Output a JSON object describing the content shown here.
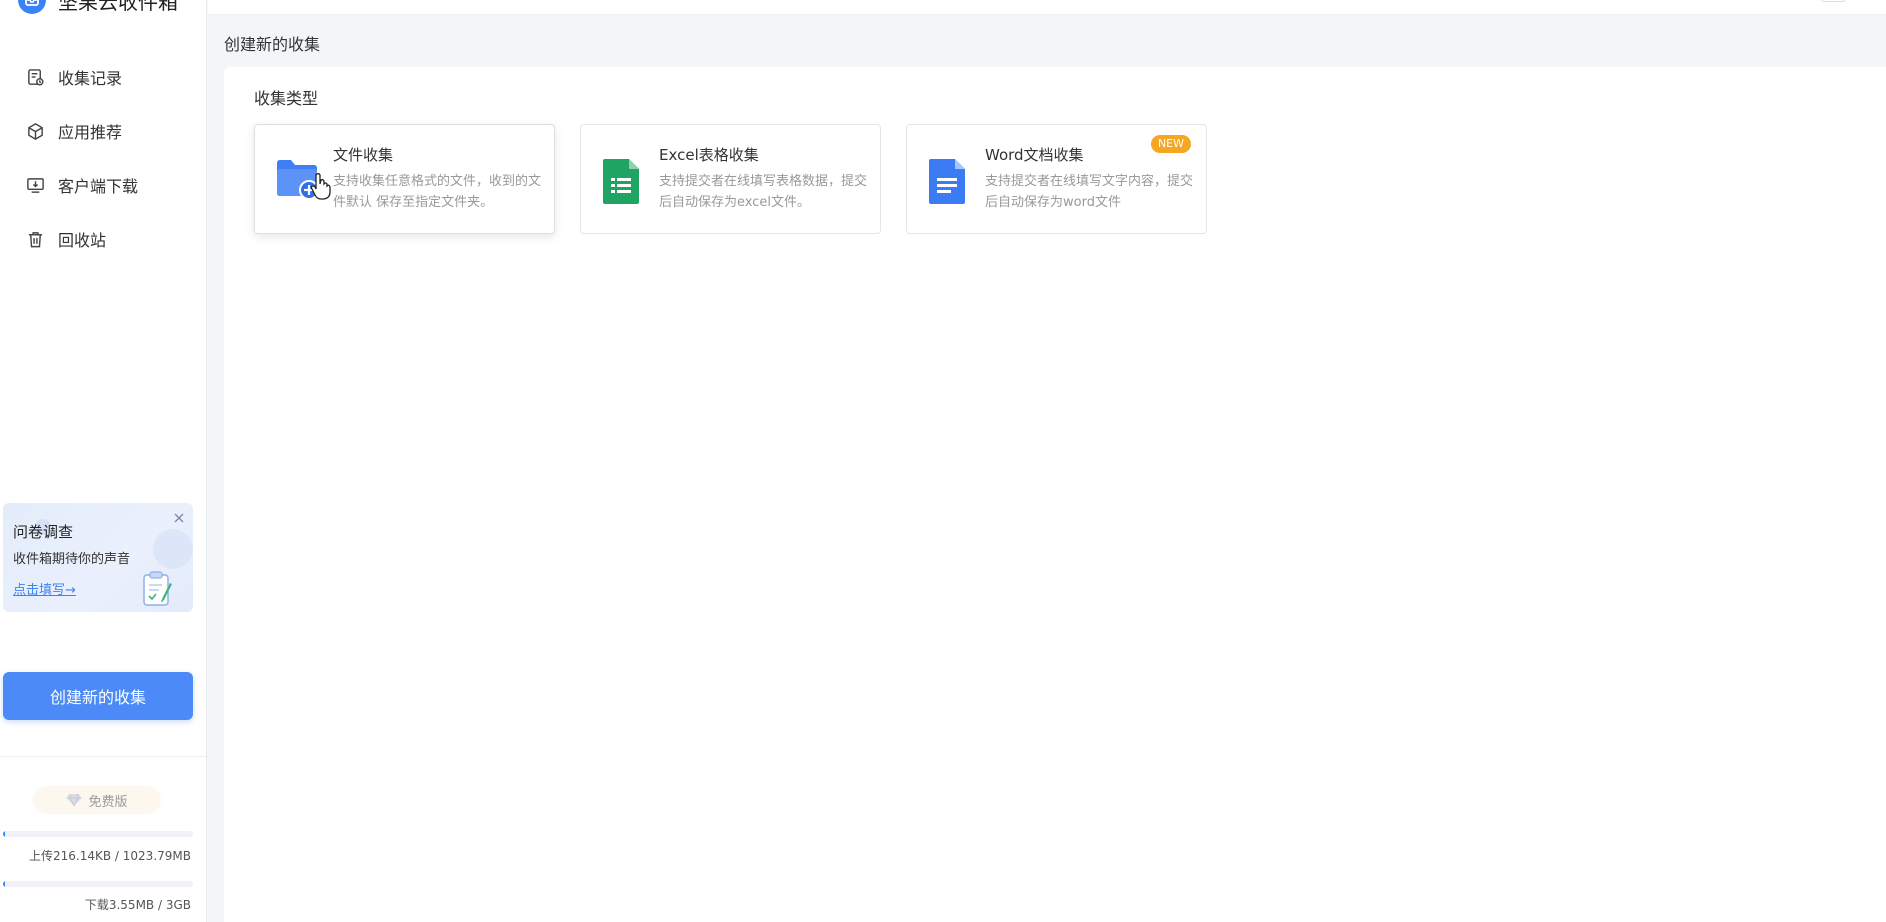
{
  "app": {
    "name": "坚果云收件箱"
  },
  "sidebar": {
    "items": [
      {
        "label": "收集记录",
        "icon": "records-icon"
      },
      {
        "label": "应用推荐",
        "icon": "cube-icon"
      },
      {
        "label": "客户端下载",
        "icon": "download-monitor-icon"
      },
      {
        "label": "回收站",
        "icon": "trash-icon"
      }
    ],
    "survey": {
      "title": "问卷调查",
      "subtitle": "收件箱期待你的声音",
      "link": "点击填写→"
    },
    "create_button": "创建新的收集",
    "plan": "免费版",
    "upload_usage": "上传216.14KB / 1023.79MB",
    "upload_fraction": 0.0002,
    "download_usage": "下载3.55MB / 3GB",
    "download_fraction": 0.0012
  },
  "main": {
    "page_title": "创建新的收集",
    "section_title": "收集类型",
    "cards": [
      {
        "title": "文件收集",
        "desc": "支持收集任意格式的文件，收到的文件默认 保存至指定文件夹。",
        "icon": "folder-add-icon"
      },
      {
        "title": "Excel表格收集",
        "desc": "支持提交者在线填写表格数据，提交后自动保存为excel文件。",
        "icon": "sheet-icon"
      },
      {
        "title": "Word文档收集",
        "desc": "支持提交者在线填写文字内容，提交后自动保存为word文件",
        "icon": "doc-icon",
        "badge": "NEW"
      }
    ]
  },
  "colors": {
    "accent": "#4b8af7",
    "excel_green": "#1fa463",
    "word_blue": "#3b7cf4",
    "badge_orange": "#f5a623"
  }
}
